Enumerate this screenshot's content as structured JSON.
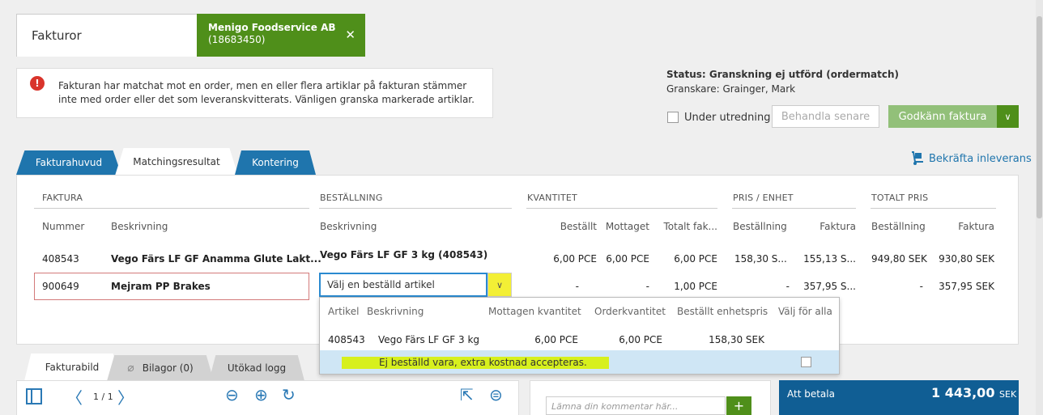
{
  "header": {
    "title_tab": "Fakturor",
    "supplier": {
      "name": "Menigo Foodservice AB",
      "id": "(18683450)",
      "close_icon": "close-icon"
    }
  },
  "alert": {
    "icon": "error-icon",
    "text": "Fakturan har matchat mot en order, men en eller flera artiklar på fakturan stämmer inte med order eller det som leveranskvitterats. Vänligen granska markerade artiklar."
  },
  "status": {
    "title": "Status: Granskning ej utförd (ordermatch)",
    "reviewer": "Granskare: Grainger, Mark",
    "under_label": "Under utredning",
    "later_label": "Behandla senare",
    "approve_label": "Godkänn faktura"
  },
  "tabs": [
    "Fakturahuvud",
    "Matchingsresultat",
    "Kontering"
  ],
  "confirm_delivery": "Bekräfta inleverans",
  "groups": {
    "faktura": "FAKTURA",
    "bestallning": "BESTÄLLNING",
    "kvantitet": "KVANTITET",
    "pris": "PRIS / ENHET",
    "totalt": "TOTALT PRIS"
  },
  "columns": {
    "nummer": "Nummer",
    "beskrivning": "Beskrivning",
    "order_beskrivning": "Beskrivning",
    "bestallt": "Beställt",
    "mottaget": "Mottaget",
    "totalt_fak": "Totalt fak...",
    "pris_bestallning": "Beställning",
    "pris_faktura": "Faktura",
    "tot_bestallning": "Beställning",
    "tot_faktura": "Faktura"
  },
  "rows": [
    {
      "nummer": "408543",
      "beskrivning": "Vego Färs LF GF Anamma Glute Lakt...",
      "order": "Vego Färs LF GF 3 kg (408543)",
      "bestallt": "6,00 PCE",
      "mottaget": "6,00 PCE",
      "totalt_fak": "6,00 PCE",
      "pris_bestallning": "158,30 S...",
      "pris_faktura": "155,13 S...",
      "tot_bestallning": "949,80 SEK",
      "tot_faktura": "930,80 SEK"
    },
    {
      "nummer": "900649",
      "beskrivning": "Mejram PP Brakes",
      "order_select": "Välj en beställd artikel",
      "bestallt": "-",
      "mottaget": "-",
      "totalt_fak": "1,00 PCE",
      "pris_bestallning": "-",
      "pris_faktura": "357,95 S...",
      "tot_bestallning": "-",
      "tot_faktura": "357,95 SEK"
    }
  ],
  "dropdown": {
    "headers": [
      "Artikel",
      "Beskrivning",
      "Mottagen kvantitet",
      "Orderkvantitet",
      "Beställt enhetspris",
      "Välj för alla"
    ],
    "item": {
      "artikel": "408543",
      "beskrivning": "Vego Färs LF GF 3 kg",
      "mottagen": "6,00 PCE",
      "order": "6,00 PCE",
      "pris": "158,30 SEK"
    },
    "extra_option": "Ej beställd vara, extra kostnad accepteras."
  },
  "bottom_tabs": [
    "Fakturabild",
    "Bilagor (0)",
    "Utökad logg"
  ],
  "viewer": {
    "page": "1 / 1"
  },
  "comment": {
    "placeholder": "Lämna din kommentar här..."
  },
  "payment": {
    "label": "Att betala",
    "amount": "1 443,00",
    "currency": "SEK"
  },
  "colors": {
    "green": "#4f8f1a",
    "blue": "#1f75ad",
    "navy": "#105e94",
    "highlight": "#d7f01d"
  }
}
